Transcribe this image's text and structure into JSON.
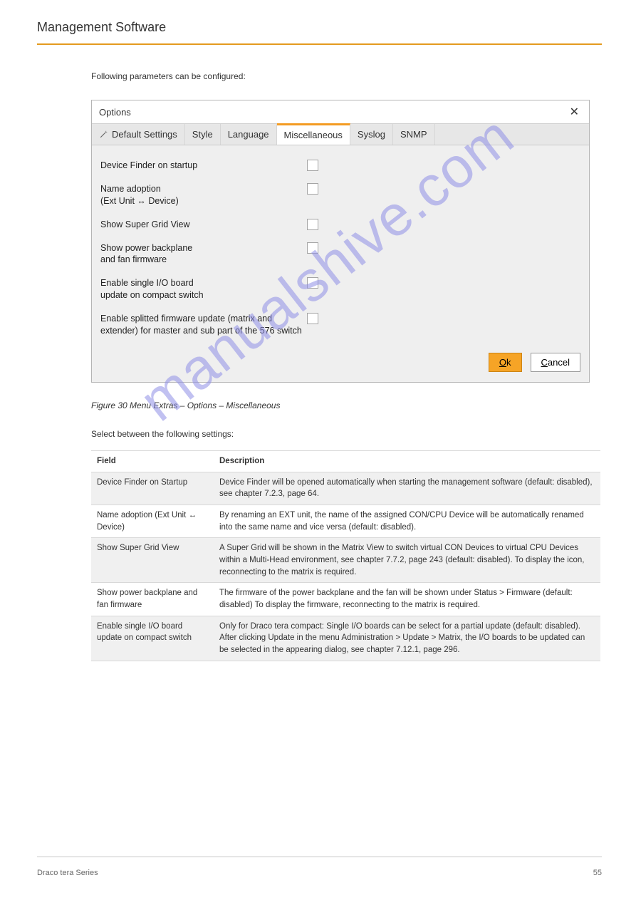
{
  "header": {
    "title": "Management Software"
  },
  "intro": "Following parameters can be configured:",
  "watermark": "manualshive.com",
  "screenshot": {
    "title": "Options",
    "tabs": [
      {
        "label": "Default Settings"
      },
      {
        "label": "Style"
      },
      {
        "label": "Language"
      },
      {
        "label": "Miscellaneous",
        "active": true
      },
      {
        "label": "Syslog"
      },
      {
        "label": "SNMP"
      }
    ],
    "options": [
      {
        "label": "Device Finder on startup"
      },
      {
        "label": "Name adoption\n(Ext Unit ↔ Device)"
      },
      {
        "label": "Show Super Grid View"
      },
      {
        "label": "Show power backplane\nand fan firmware"
      },
      {
        "label": "Enable single I/O board\nupdate on compact switch"
      },
      {
        "label": "Enable splitted firmware update (matrix and extender) for master and sub part of the 576 switch"
      }
    ],
    "buttons": {
      "ok": "Ok",
      "ok_u": "O",
      "ok_rest": "k",
      "cancel": "Cancel",
      "cancel_u": "C",
      "cancel_rest": "ancel"
    }
  },
  "caption": "Figure 30 Menu Extras – Options – Miscellaneous",
  "section_sub": "Select between the following settings:",
  "table": {
    "head": {
      "c1": "Field",
      "c2": "Description"
    },
    "rows": [
      {
        "c1": "Device Finder on Startup",
        "c2": "Device Finder will be opened automatically when starting the management software (default: disabled), see chapter 7.2.3, page 64."
      },
      {
        "c1": "Name adoption (Ext Unit ↔ Device)",
        "c2": "By renaming an EXT unit, the name of the assigned CON/CPU Device will be automatically renamed into the same name and vice versa (default: disabled)."
      },
      {
        "c1": "Show Super Grid View",
        "c2": "A Super Grid will be shown in the Matrix View to switch virtual CON Devices to virtual CPU Devices within a Multi-Head environment, see chapter 7.7.2, page 243 (default: disabled). To display the icon, reconnecting to the matrix is required."
      },
      {
        "c1": "Show power backplane and fan firmware",
        "c2": "The firmware of the power backplane and the fan will be shown under Status > Firmware (default: disabled) To display the firmware, reconnecting to the matrix is required."
      },
      {
        "c1": "Enable single I/O board update on compact switch",
        "c2": "Only for Draco tera compact: Single I/O boards can be select for a partial update (default: disabled). After clicking Update in the menu Administration > Update > Matrix, the I/O boards to be updated can be selected in the appearing dialog, see chapter 7.12.1, page 296."
      }
    ]
  },
  "footer": {
    "left": "Draco tera Series",
    "right": "55"
  }
}
